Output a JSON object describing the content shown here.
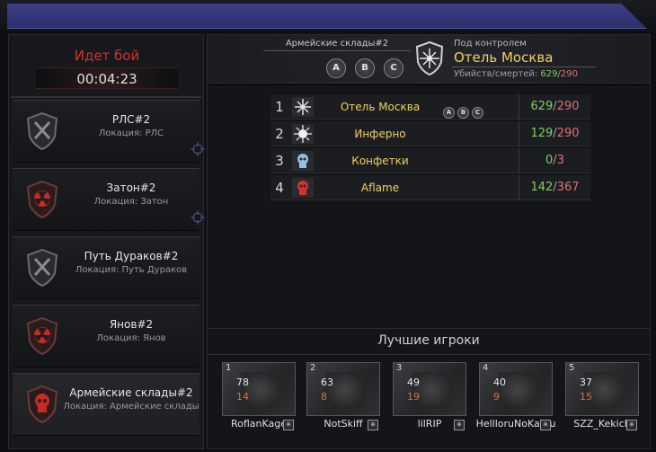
{
  "battle": {
    "status": "Идет бой",
    "timer": "00:04:23"
  },
  "locations": [
    {
      "name": "РЛС#2",
      "location": "Локация: РЛС",
      "emblem": "grey-crossed-swords-shield-icon"
    },
    {
      "name": "Затон#2",
      "location": "Локация: Затон",
      "emblem": "red-radiation-shield-icon"
    },
    {
      "name": "Путь Дураков#2",
      "location": "Локация: Путь Дураков",
      "emblem": "grey-crossed-swords-shield-icon"
    },
    {
      "name": "Янов#2",
      "location": "Локация: Янов",
      "emblem": "red-radiation-shield-icon"
    },
    {
      "name": "Армейские склады#2",
      "location": "Локация: Армейские склады",
      "emblem": "red-skull-shield-icon"
    }
  ],
  "header": {
    "location_name": "Армейские склады#2",
    "flags": [
      "A",
      "B",
      "C"
    ],
    "control_label": "Под контролем",
    "controller": "Отель Москва",
    "kd_label": "Убийств/смертей:",
    "kills": "629",
    "deaths": "290"
  },
  "standings": [
    {
      "rank": "1",
      "name": "Отель Москва",
      "flags": [
        "A",
        "B",
        "C"
      ],
      "kills": "629",
      "deaths": "290",
      "emblem": "compass-star-icon"
    },
    {
      "rank": "2",
      "name": "Инферно",
      "flags": [],
      "kills": "129",
      "deaths": "290",
      "emblem": "burst-icon"
    },
    {
      "rank": "3",
      "name": "Конфетки",
      "flags": [],
      "kills": "0",
      "deaths": "3",
      "emblem": "blue-skull-icon"
    },
    {
      "rank": "4",
      "name": "Aflame",
      "flags": [],
      "kills": "142",
      "deaths": "367",
      "emblem": "red-skull-icon"
    }
  ],
  "best_players": {
    "title": "Лучшие игроки",
    "players": [
      {
        "rank": "1",
        "name": "RoflanKage",
        "kills": "78",
        "deaths": "14"
      },
      {
        "rank": "2",
        "name": "NotSkiff",
        "kills": "63",
        "deaths": "8"
      },
      {
        "rank": "3",
        "name": "lilRIP",
        "kills": "49",
        "deaths": "19"
      },
      {
        "rank": "4",
        "name": "HellloruNoKamu",
        "kills": "40",
        "deaths": "9"
      },
      {
        "rank": "5",
        "name": "SZZ_Kekich",
        "kills": "37",
        "deaths": "15"
      }
    ]
  },
  "colors": {
    "accent_gold": "#f0d060",
    "kills_green": "#7fd060",
    "deaths_red": "#e07070",
    "battle_red": "#d8312c"
  }
}
